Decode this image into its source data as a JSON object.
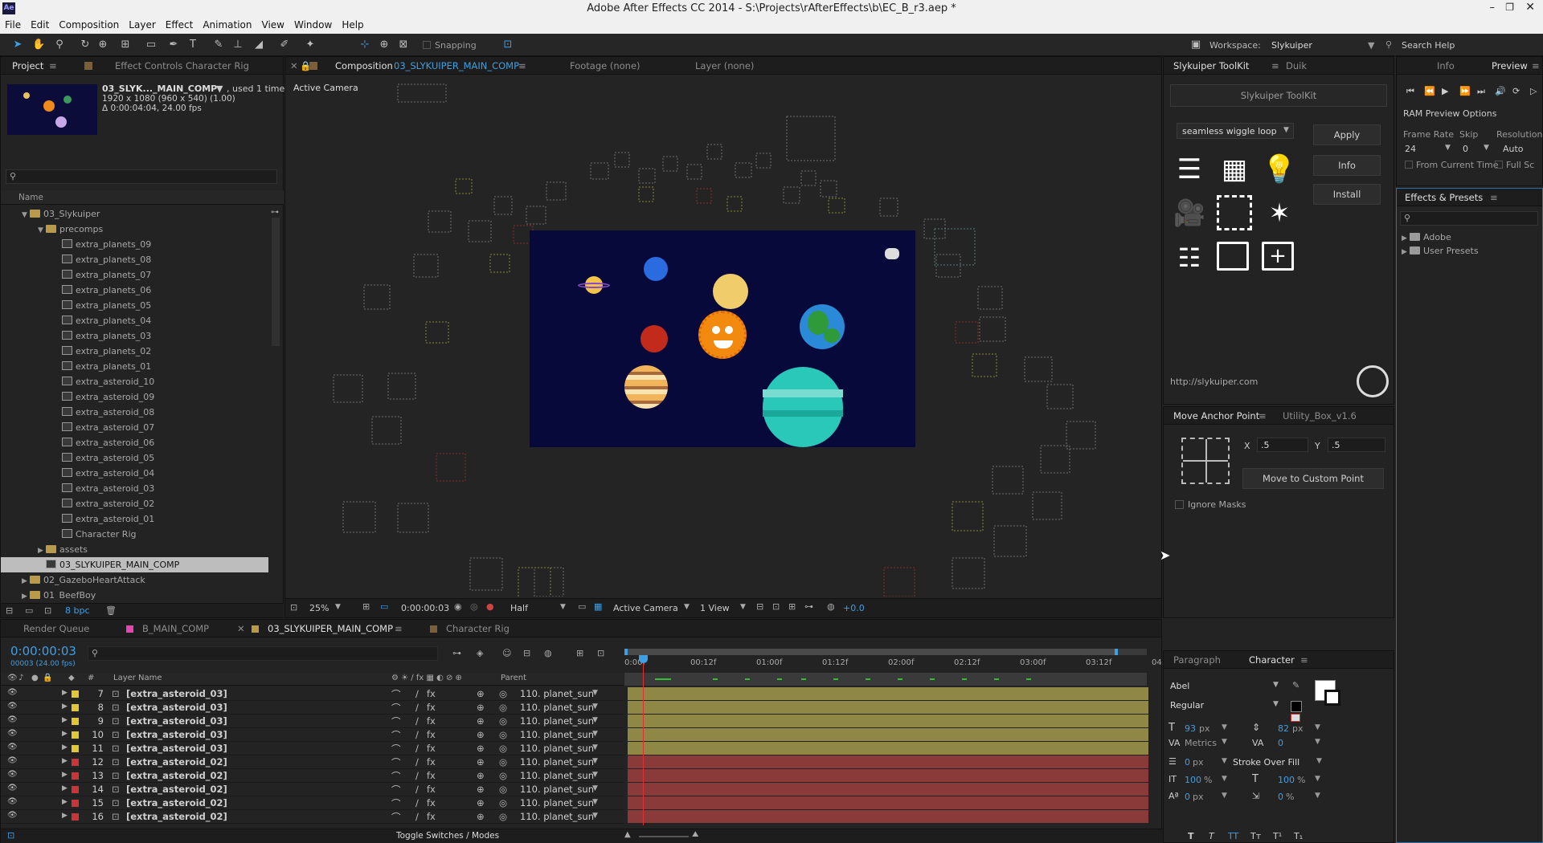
{
  "window": {
    "title": "Adobe After Effects CC 2014 - S:\\Projects\\rAfterEffects\\b\\EC_B_r3.aep *"
  },
  "menu": [
    "File",
    "Edit",
    "Composition",
    "Layer",
    "Effect",
    "Animation",
    "View",
    "Window",
    "Help"
  ],
  "toolbar": {
    "snapping": "Snapping",
    "workspace_label": "Workspace:",
    "workspace_value": "Slykuiper",
    "search_help": "Search Help"
  },
  "project": {
    "tab": "Project",
    "tab2": "Effect Controls Character Rig",
    "comp_name": "03_SLYK..._MAIN_COMP",
    "used": ", used 1 time",
    "size": "1920 x 1080  (960 x 540) (1.00)",
    "duration": "Δ 0:00:04:04, 24.00 fps",
    "col_name": "Name",
    "items": [
      {
        "label": "03_Slykuiper",
        "type": "folder",
        "indent": 1,
        "open": true
      },
      {
        "label": "precomps",
        "type": "folder",
        "indent": 2,
        "open": true
      },
      {
        "label": "extra_planets_09",
        "type": "comp",
        "indent": 3
      },
      {
        "label": "extra_planets_08",
        "type": "comp",
        "indent": 3
      },
      {
        "label": "extra_planets_07",
        "type": "comp",
        "indent": 3
      },
      {
        "label": "extra_planets_06",
        "type": "comp",
        "indent": 3
      },
      {
        "label": "extra_planets_05",
        "type": "comp",
        "indent": 3
      },
      {
        "label": "extra_planets_04",
        "type": "comp",
        "indent": 3
      },
      {
        "label": "extra_planets_03",
        "type": "comp",
        "indent": 3
      },
      {
        "label": "extra_planets_02",
        "type": "comp",
        "indent": 3
      },
      {
        "label": "extra_planets_01",
        "type": "comp",
        "indent": 3
      },
      {
        "label": "extra_asteroid_10",
        "type": "comp",
        "indent": 3
      },
      {
        "label": "extra_asteroid_09",
        "type": "comp",
        "indent": 3
      },
      {
        "label": "extra_asteroid_08",
        "type": "comp",
        "indent": 3
      },
      {
        "label": "extra_asteroid_07",
        "type": "comp",
        "indent": 3
      },
      {
        "label": "extra_asteroid_06",
        "type": "comp",
        "indent": 3
      },
      {
        "label": "extra_asteroid_05",
        "type": "comp",
        "indent": 3
      },
      {
        "label": "extra_asteroid_04",
        "type": "comp",
        "indent": 3
      },
      {
        "label": "extra_asteroid_03",
        "type": "comp",
        "indent": 3
      },
      {
        "label": "extra_asteroid_02",
        "type": "comp",
        "indent": 3
      },
      {
        "label": "extra_asteroid_01",
        "type": "comp",
        "indent": 3
      },
      {
        "label": "Character Rig",
        "type": "comp",
        "indent": 3
      },
      {
        "label": "assets",
        "type": "folder",
        "indent": 2,
        "open": false
      },
      {
        "label": "03_SLYKUIPER_MAIN_COMP",
        "type": "comp",
        "indent": 2,
        "selected": true
      },
      {
        "label": "02_GazeboHeartAttack",
        "type": "folder",
        "indent": 1,
        "open": false
      },
      {
        "label": "01_BeefBoy",
        "type": "folder",
        "indent": 1,
        "open": false
      }
    ],
    "bpc": "8 bpc"
  },
  "comp_viewer": {
    "tab_composition": "Composition",
    "tab_comp_name": "03_SLYKUIPER_MAIN_COMP",
    "tab_footage": "Footage (none)",
    "tab_layer": "Layer (none)",
    "active_camera": "Active Camera",
    "zoom": "25%",
    "timecode": "0:00:00:03",
    "resolution": "Half",
    "camera": "Active Camera",
    "views": "1 View",
    "exposure": "+0.0"
  },
  "toolkit": {
    "tab": "Slykuiper ToolKit",
    "tab2": "Duik",
    "header": "Slykuiper ToolKit",
    "dropdown": "seamless wiggle loop",
    "apply": "Apply",
    "info": "Info",
    "install": "Install",
    "url": "http://slykuiper.com"
  },
  "anchor": {
    "tab": "Move Anchor Point",
    "tab2": "Utility_Box_v1.6",
    "x_label": "X",
    "x_value": ".5",
    "y_label": "Y",
    "y_value": ".5",
    "button": "Move to Custom Point",
    "ignore_masks": "Ignore Masks"
  },
  "preview": {
    "tab_info": "Info",
    "tab_preview": "Preview",
    "ram_options": "RAM Preview Options",
    "frame_rate_label": "Frame Rate",
    "skip_label": "Skip",
    "resolution_label": "Resolution",
    "frame_rate": "24",
    "skip": "0",
    "resolution": "Auto",
    "from_current": "From Current Time",
    "full_screen": "Full Sc"
  },
  "effects": {
    "tab": "Effects & Presets",
    "items": [
      "Adobe",
      "User Presets"
    ]
  },
  "timeline": {
    "tab_render": "Render Queue",
    "tab_b": "B_MAIN_COMP",
    "tab_main": "03_SLYKUIPER_MAIN_COMP",
    "tab_char": "Character Rig",
    "timecode": "0:00:00:03",
    "fps": "00003 (24.00 fps)",
    "col_num": "#",
    "col_layer": "Layer Name",
    "col_parent": "Parent",
    "toggle": "Toggle Switches / Modes",
    "ruler": [
      "0:00f",
      "00:12f",
      "01:00f",
      "01:12f",
      "02:00f",
      "02:12f",
      "03:00f",
      "03:12f",
      "04:"
    ],
    "layers": [
      {
        "num": "7",
        "name": "[extra_asteroid_03]",
        "parent": "110. planet_sun",
        "color": "#e0c73a",
        "bar": "#8e8745"
      },
      {
        "num": "8",
        "name": "[extra_asteroid_03]",
        "parent": "110. planet_sun",
        "color": "#e0c73a",
        "bar": "#8e8745"
      },
      {
        "num": "9",
        "name": "[extra_asteroid_03]",
        "parent": "110. planet_sun",
        "color": "#e0c73a",
        "bar": "#8e8745"
      },
      {
        "num": "10",
        "name": "[extra_asteroid_03]",
        "parent": "110. planet_sun",
        "color": "#e0c73a",
        "bar": "#8e8745"
      },
      {
        "num": "11",
        "name": "[extra_asteroid_03]",
        "parent": "110. planet_sun",
        "color": "#e0c73a",
        "bar": "#8e8745"
      },
      {
        "num": "12",
        "name": "[extra_asteroid_02]",
        "parent": "110. planet_sun",
        "color": "#c8363a",
        "bar": "#8a3a38"
      },
      {
        "num": "13",
        "name": "[extra_asteroid_02]",
        "parent": "110. planet_sun",
        "color": "#c8363a",
        "bar": "#8a3a38"
      },
      {
        "num": "14",
        "name": "[extra_asteroid_02]",
        "parent": "110. planet_sun",
        "color": "#c8363a",
        "bar": "#8a3a38"
      },
      {
        "num": "15",
        "name": "[extra_asteroid_02]",
        "parent": "110. planet_sun",
        "color": "#c8363a",
        "bar": "#8a3a38"
      },
      {
        "num": "16",
        "name": "[extra_asteroid_02]",
        "parent": "110. planet_sun",
        "color": "#c8363a",
        "bar": "#8a3a38"
      }
    ]
  },
  "character": {
    "tab_paragraph": "Paragraph",
    "tab_character": "Character",
    "font": "Abel",
    "style": "Regular",
    "size": "93",
    "size_unit": "px",
    "leading": "82",
    "leading_unit": "px",
    "kerning": "Metrics",
    "tracking": "0",
    "stroke_width": "0",
    "stroke_unit": "px",
    "stroke_mode": "Stroke Over Fill",
    "vscale": "100",
    "hscale": "100",
    "baseline": "0",
    "baseline_unit": "px",
    "tsume": "0",
    "pct": "%"
  }
}
